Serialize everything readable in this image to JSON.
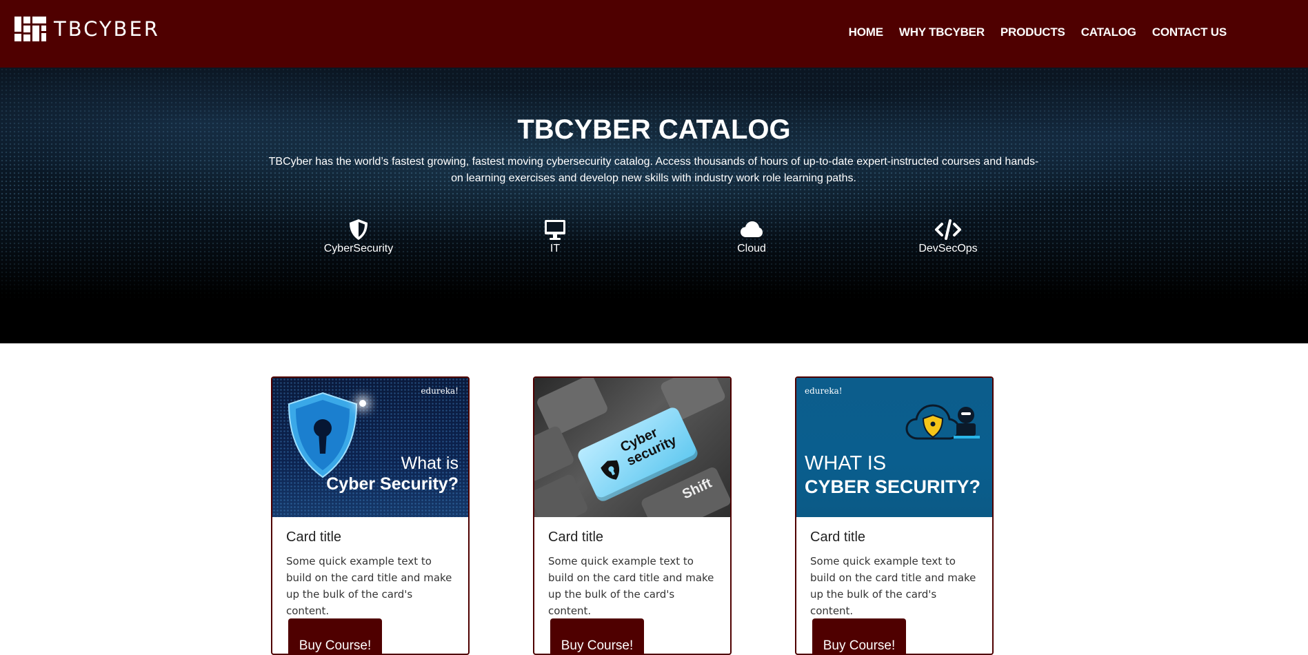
{
  "brand": {
    "name": "TBCYBER"
  },
  "nav": {
    "items": [
      {
        "label": "HOME"
      },
      {
        "label": "WHY TBCYBER"
      },
      {
        "label": "PRODUCTS"
      },
      {
        "label": "CATALOG"
      },
      {
        "label": "CONTACT US"
      }
    ]
  },
  "hero": {
    "title": "TBCYBER CATALOG",
    "description": "TBCyber has the world’s fastest growing, fastest moving cybersecurity catalog. Access thousands of hours of up-to-date expert-instructed courses and hands-on learning exercises and develop new skills with industry work role learning paths.",
    "categories": [
      {
        "label": "CyberSecurity",
        "icon": "shield-halved-icon"
      },
      {
        "label": "IT",
        "icon": "desktop-monitor-icon"
      },
      {
        "label": "Cloud",
        "icon": "cloud-icon"
      },
      {
        "label": "DevSecOps",
        "icon": "code-icon"
      }
    ]
  },
  "cards": [
    {
      "title": "Card title",
      "text": "Some quick example text to build on the card title and make up the bulk of the card's content.",
      "button": "Buy Course!",
      "image": {
        "brand": "edureka!",
        "line1": "What is",
        "line2": "Cyber Security?"
      }
    },
    {
      "title": "Card title",
      "text": "Some quick example text to build on the card title and make up the bulk of the card's content.",
      "button": "Buy Course!",
      "image": {
        "key_label": "Cyber security",
        "shift_label": "Shift"
      }
    },
    {
      "title": "Card title",
      "text": "Some quick example text to build on the card title and make up the bulk of the card's content.",
      "button": "Buy Course!",
      "image": {
        "brand": "edureka!",
        "line1": "WHAT IS",
        "line2": "CYBER SECURITY?"
      }
    }
  ],
  "colors": {
    "brand_dark_red": "#4f0000",
    "hero_bg": "#000000",
    "page_bg": "#ffffff"
  }
}
